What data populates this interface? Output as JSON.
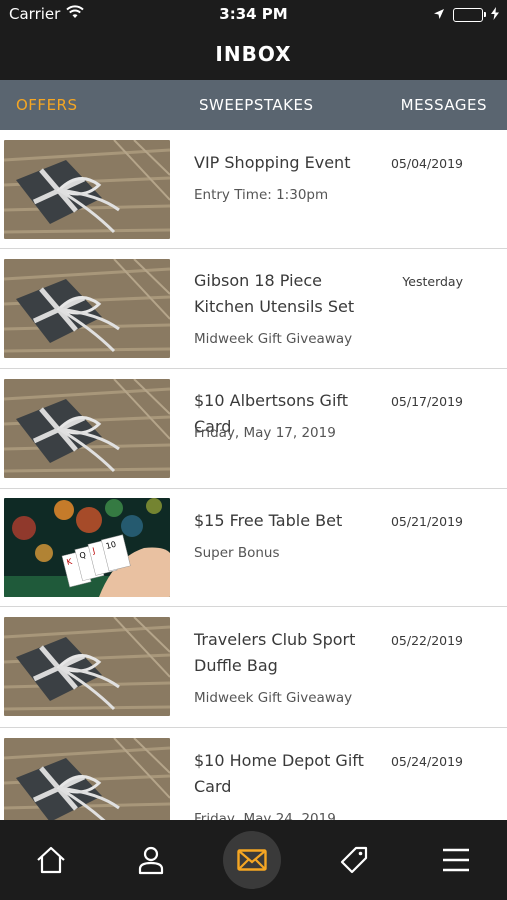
{
  "status": {
    "carrier": "Carrier",
    "time": "3:34 PM"
  },
  "header": {
    "title": "INBOX"
  },
  "tabs": [
    {
      "label": "OFFERS",
      "active": true
    },
    {
      "label": "SWEEPSTAKES",
      "active": false
    },
    {
      "label": "MESSAGES",
      "active": false
    }
  ],
  "items": [
    {
      "title": "VIP Shopping Event",
      "subtitle": "Entry Time: 1:30pm",
      "date": "05/04/2019",
      "image": "gift-image"
    },
    {
      "title": "Gibson 18 Piece Kitchen Utensils Set",
      "subtitle": "Midweek Gift Giveaway",
      "date": "Yesterday",
      "image": "gift-image"
    },
    {
      "title": "$10 Albertsons Gift Card",
      "subtitle": "Friday, May 17, 2019",
      "date": "05/17/2019",
      "image": "gift-image"
    },
    {
      "title": "$15 Free Table Bet",
      "subtitle": "Super Bonus",
      "date": "05/21/2019",
      "image": "playing-cards-image"
    },
    {
      "title": "Travelers Club Sport Duffle Bag",
      "subtitle": "Midweek Gift Giveaway",
      "date": "05/22/2019",
      "image": "gift-image"
    },
    {
      "title": "$10 Home Depot Gift Card",
      "subtitle": "Friday, May 24, 2019",
      "date": "05/24/2019",
      "image": "gift-image"
    }
  ],
  "nav": [
    {
      "icon": "home-icon"
    },
    {
      "icon": "profile-icon"
    },
    {
      "icon": "mail-icon",
      "active": true
    },
    {
      "icon": "tag-icon"
    },
    {
      "icon": "menu-icon"
    }
  ],
  "colors": {
    "accent": "#f5a623",
    "header": "#1c1c1c",
    "tabbar": "#5a6570"
  }
}
